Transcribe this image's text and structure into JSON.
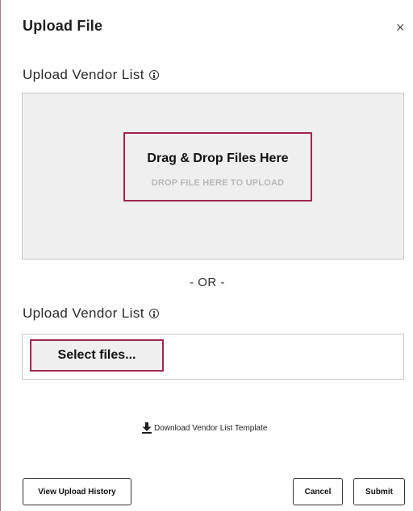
{
  "dialog": {
    "title": "Upload File",
    "close_label": "×"
  },
  "dropzone_section": {
    "label": "Upload Vendor List",
    "heading": "Drag & Drop Files Here",
    "subtext": "DROP FILE HERE TO UPLOAD"
  },
  "separator": {
    "text": "- OR -"
  },
  "select_section": {
    "label": "Upload Vendor List",
    "button_label": "Select files..."
  },
  "download": {
    "label": "Download Vendor List Template",
    "icon": "download-icon"
  },
  "footer": {
    "history_label": "View Upload History",
    "cancel_label": "Cancel",
    "submit_label": "Submit"
  },
  "colors": {
    "accent_border": "#a0264f",
    "dropzone_bg": "#efefef",
    "dropzone_border": "#c9c9c9"
  }
}
